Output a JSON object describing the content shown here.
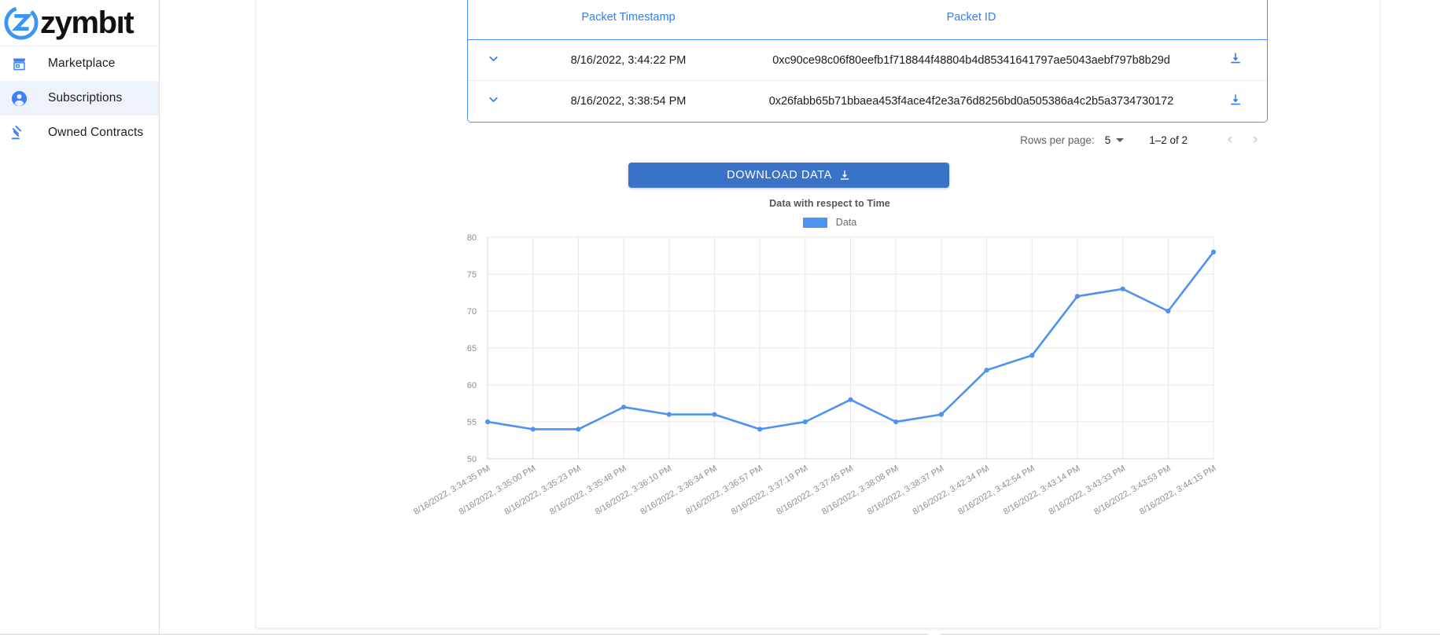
{
  "sidebar": {
    "logo": {
      "word": "zymbıt",
      "icon": "zymbit-logo-icon"
    },
    "items": [
      {
        "label": "Marketplace",
        "icon": "storefront-icon",
        "active": false
      },
      {
        "label": "Subscriptions",
        "icon": "account-circle-icon",
        "active": true
      },
      {
        "label": "Owned Contracts",
        "icon": "gavel-icon",
        "active": false
      }
    ]
  },
  "table": {
    "headers": {
      "expand": "",
      "timestamp": "Packet Timestamp",
      "packet_id": "Packet ID",
      "download": ""
    },
    "rows": [
      {
        "timestamp": "8/16/2022, 3:44:22 PM",
        "packet_id": "0xc90ce98c06f80eefb1f718844f48804b4d85341641797ae5043aebf797b8b29d",
        "expand_icon": "chevron-down-icon",
        "download_icon": "download-icon"
      },
      {
        "timestamp": "8/16/2022, 3:38:54 PM",
        "packet_id": "0x26fabb65b71bbaea453f4ace4f2e3a76d8256bd0a505386a4c2b5a3734730172",
        "expand_icon": "chevron-down-icon",
        "download_icon": "download-icon"
      }
    ]
  },
  "pagination": {
    "rows_per_page_label": "Rows per page:",
    "rows_per_page_value": "5",
    "range_label": "1–2 of 2",
    "prev_glyph": "‹",
    "next_glyph": "›"
  },
  "download_button": {
    "label": "DOWNLOAD DATA",
    "icon": "download-icon"
  },
  "colors": {
    "accent_blue": "#3a72c8",
    "link_blue": "#2f7ef0",
    "chart_line": "#4f93f0",
    "sidebar_active": "#eef3fb"
  },
  "chart_data": {
    "type": "line",
    "title": "Data with respect to Time",
    "xlabel": "",
    "ylabel": "",
    "ylim": [
      50,
      80
    ],
    "yticks": [
      50,
      55,
      60,
      65,
      70,
      75,
      80
    ],
    "grid": true,
    "legend_position": "top-center",
    "legend": [
      "Data"
    ],
    "categories": [
      "8/16/2022, 3:34:35 PM",
      "8/16/2022, 3:35:00 PM",
      "8/16/2022, 3:35:23 PM",
      "8/16/2022, 3:35:48 PM",
      "8/16/2022, 3:36:10 PM",
      "8/16/2022, 3:36:34 PM",
      "8/16/2022, 3:36:57 PM",
      "8/16/2022, 3:37:19 PM",
      "8/16/2022, 3:37:45 PM",
      "8/16/2022, 3:38:08 PM",
      "8/16/2022, 3:38:37 PM",
      "8/16/2022, 3:42:34 PM",
      "8/16/2022, 3:42:54 PM",
      "8/16/2022, 3:43:14 PM",
      "8/16/2022, 3:43:33 PM",
      "8/16/2022, 3:43:53 PM",
      "8/16/2022, 3:44:15 PM"
    ],
    "series": [
      {
        "name": "Data",
        "color": "#4f93f0",
        "values": [
          55,
          54,
          54,
          57,
          56,
          56,
          54,
          55,
          58,
          55,
          56,
          62,
          64,
          72,
          73,
          70,
          78
        ]
      }
    ]
  }
}
